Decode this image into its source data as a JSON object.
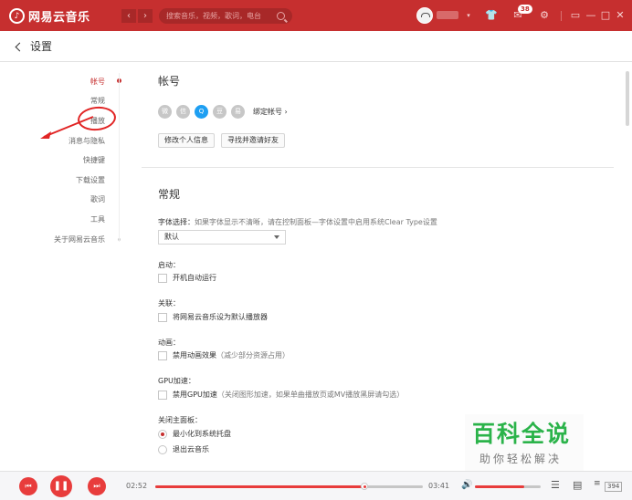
{
  "titlebar": {
    "app_name": "网易云音乐",
    "back_glyph": "‹",
    "forward_glyph": "›",
    "search_placeholder": "搜索音乐，视频，歌词，电台",
    "message_badge": "38",
    "icons": [
      "clothes-icon",
      "mail-icon",
      "gear-icon",
      "mini-mode-icon",
      "minimize-icon",
      "maximize-icon",
      "close-icon"
    ]
  },
  "header": {
    "title": "设置"
  },
  "sidebar": {
    "items": [
      {
        "label": "帐号",
        "active": true
      },
      {
        "label": "常规",
        "active": false
      },
      {
        "label": "播放",
        "active": false
      },
      {
        "label": "消息与隐私",
        "active": false
      },
      {
        "label": "快捷键",
        "active": false
      },
      {
        "label": "下载设置",
        "active": false
      },
      {
        "label": "歌词",
        "active": false
      },
      {
        "label": "工具",
        "active": false
      },
      {
        "label": "关于网易云音乐",
        "active": false
      }
    ]
  },
  "account": {
    "title": "帐号",
    "bind_label": "绑定帐号",
    "edit_profile": "修改个人信息",
    "find_friends": "寻找并邀请好友"
  },
  "general": {
    "title": "常规",
    "font_label": "字体选择：",
    "font_hint": "如果字体显示不清晰，请在控制面板—字体设置中启用系统Clear Type设置",
    "font_value": "默认",
    "startup_label": "启动：",
    "startup_option": "开机自动运行",
    "assoc_label": "关联：",
    "assoc_option": "将网易云音乐设为默认播放器",
    "anim_label": "动画：",
    "anim_option": "禁用动画效果",
    "anim_hint": "（减少部分资源占用）",
    "gpu_label": "GPU加速：",
    "gpu_option": "禁用GPU加速",
    "gpu_hint": "（关闭图形加速，如果单曲播放页或MV播放黑屏请勾选）",
    "close_label": "关闭主面板：",
    "close_opt1": "最小化到系统托盘",
    "close_opt2": "退出云音乐"
  },
  "watermark": {
    "main": "百科全说",
    "sub": "助你轻松解决"
  },
  "player": {
    "current_time": "02:52",
    "total_time": "03:41",
    "progress": 0.78,
    "volume": 0.75,
    "playlist_count": "394"
  },
  "colors": {
    "brand": "#c62f2f",
    "player_red": "#e83c3c",
    "watermark_green": "#2bb34a",
    "annotation": "#e12424"
  }
}
